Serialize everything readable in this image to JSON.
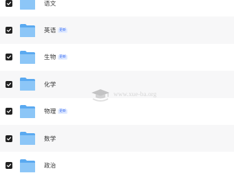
{
  "folders": [
    {
      "name": "语文",
      "badge": ""
    },
    {
      "name": "英语",
      "badge": "更新"
    },
    {
      "name": "生物",
      "badge": "更新"
    },
    {
      "name": "化学",
      "badge": ""
    },
    {
      "name": "物理",
      "badge": "更新"
    },
    {
      "name": "数学",
      "badge": ""
    },
    {
      "name": "政治",
      "badge": ""
    }
  ],
  "watermark": {
    "text": "www.xue-ba.org"
  },
  "colors": {
    "folder_blue": "#5aa9f0",
    "folder_blue_light": "#8cc6f7",
    "badge_bg": "#e3ecff",
    "badge_text": "#3b6ff5",
    "checkbox": "#222222"
  }
}
